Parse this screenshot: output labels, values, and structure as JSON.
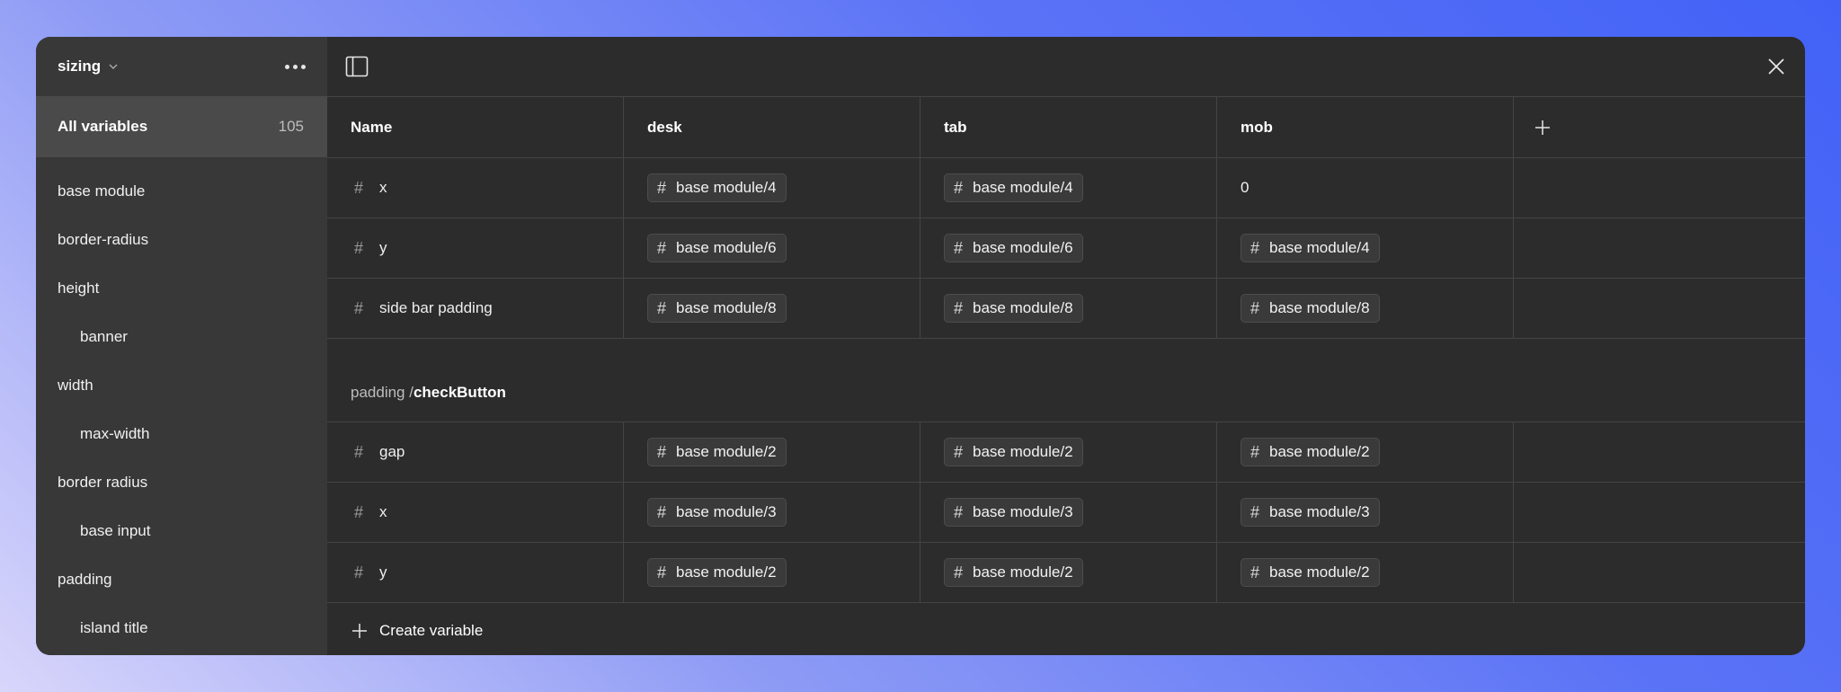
{
  "sidebar": {
    "collection_name": "sizing",
    "all_variables": {
      "label": "All variables",
      "count": "105"
    },
    "items": [
      {
        "label": "base module",
        "child": false
      },
      {
        "label": "border-radius",
        "child": false
      },
      {
        "label": "height",
        "child": false
      },
      {
        "label": "banner",
        "child": true
      },
      {
        "label": "width",
        "child": false
      },
      {
        "label": "max-width",
        "child": true
      },
      {
        "label": "border radius",
        "child": false
      },
      {
        "label": "base input",
        "child": true
      },
      {
        "label": "padding",
        "child": false
      },
      {
        "label": "island title",
        "child": true
      }
    ]
  },
  "table": {
    "headers": [
      "Name",
      "desk",
      "tab",
      "mob"
    ],
    "group1_rows": [
      {
        "name": "x",
        "desk": "base module/4",
        "tab": "base module/4",
        "mob": "0",
        "mob_plain": true
      },
      {
        "name": "y",
        "desk": "base module/6",
        "tab": "base module/6",
        "mob": "base module/4",
        "mob_plain": false
      },
      {
        "name": "side bar padding",
        "desk": "base module/8",
        "tab": "base module/8",
        "mob": "base module/8",
        "mob_plain": false
      }
    ],
    "group2": {
      "prefix": "padding / ",
      "name": "checkButton"
    },
    "group2_rows": [
      {
        "name": "gap",
        "desk": "base module/2",
        "tab": "base module/2",
        "mob": "base module/2"
      },
      {
        "name": "x",
        "desk": "base module/3",
        "tab": "base module/3",
        "mob": "base module/3"
      },
      {
        "name": "y",
        "desk": "base module/2",
        "tab": "base module/2",
        "mob": "base module/2"
      }
    ],
    "create_label": "Create variable"
  },
  "icons": {
    "hash": "#",
    "collapse_panel": "panel-icon",
    "close": "close-icon",
    "more": "more-icon",
    "add": "plus-icon"
  }
}
